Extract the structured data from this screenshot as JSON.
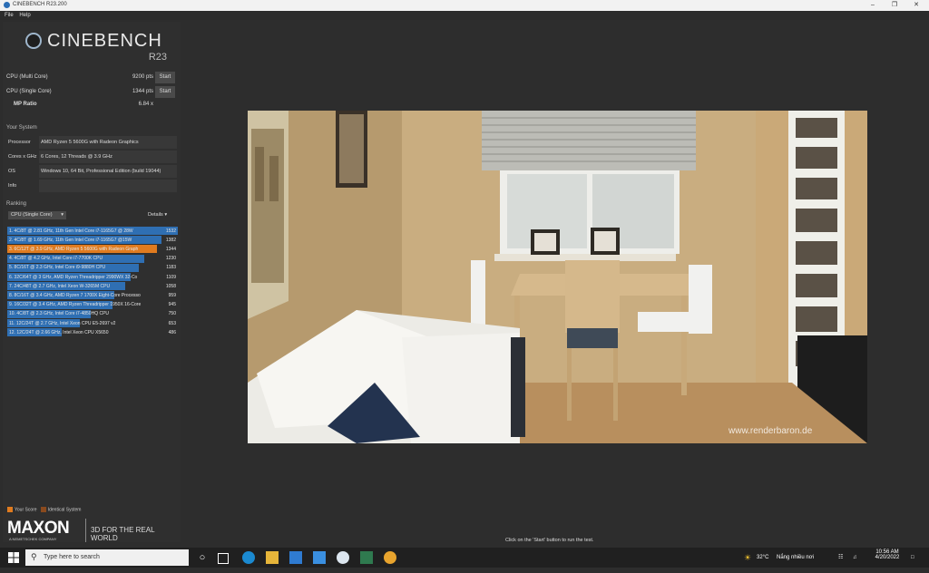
{
  "window": {
    "title": "CINEBENCH R23.200",
    "controls": [
      "minimize-icon",
      "maximize-icon",
      "close-icon"
    ]
  },
  "menu": {
    "items": [
      "File",
      "Help"
    ]
  },
  "logo": {
    "name": "CINEBENCH",
    "version": "R23"
  },
  "benchmarks": [
    {
      "label": "CPU (Multi Core)",
      "points": "9200 pts",
      "button": "Start"
    },
    {
      "label": "CPU (Single Core)",
      "points": "1344 pts",
      "button": "Start"
    }
  ],
  "mp_ratio": {
    "label": "MP Ratio",
    "value": "6.84 x"
  },
  "your_system": {
    "heading": "Your System",
    "rows": [
      {
        "key": "Processor",
        "value": "AMD Ryzen 5 5600G with Radeon Graphics"
      },
      {
        "key": "Cores x GHz",
        "value": "6 Cores, 12 Threads @ 3.9 GHz"
      },
      {
        "key": "OS",
        "value": "Windows 10, 64 Bit, Professional Edition (build 19044)"
      },
      {
        "key": "Info",
        "value": ""
      }
    ]
  },
  "ranking": {
    "heading": "Ranking",
    "dropdown": "CPU (Single Core)",
    "details": "Details",
    "max_score": 1532,
    "items": [
      {
        "label": "1. 4C/8T @ 2.81 GHz, 11th Gen Intel Core i7-1165G7 @ 28W",
        "score": "1532",
        "value": 1532,
        "highlight": false
      },
      {
        "label": "2. 4C/8T @ 1.69 GHz, 11th Gen Intel Core i7-1165G7 @15W",
        "score": "1382",
        "value": 1382,
        "highlight": false
      },
      {
        "label": "3. 6C/12T @ 3.9 GHz, AMD Ryzen 5 5600G with Radeon Graph",
        "score": "1344",
        "value": 1344,
        "highlight": true
      },
      {
        "label": "4. 4C/8T @ 4.2 GHz, Intel Core i7-7700K CPU",
        "score": "1230",
        "value": 1230,
        "highlight": false
      },
      {
        "label": "5. 8C/16T @ 2.3 GHz, Intel Core i9-9880H CPU",
        "score": "1183",
        "value": 1183,
        "highlight": false
      },
      {
        "label": "6. 32C/64T @ 3 GHz, AMD Ryzen Threadripper 2990WX 32-Co",
        "score": "1109",
        "value": 1109,
        "highlight": false
      },
      {
        "label": "7. 24C/48T @ 2.7 GHz, Intel Xeon W-3265M CPU",
        "score": "1058",
        "value": 1058,
        "highlight": false
      },
      {
        "label": "8. 8C/16T @ 3.4 GHz, AMD Ryzen 7 1700X Eight-Core Processo",
        "score": "959",
        "value": 959,
        "highlight": false
      },
      {
        "label": "9. 16C/32T @ 3.4 GHz, AMD Ryzen Threadripper 1950X 16-Core",
        "score": "945",
        "value": 945,
        "highlight": false
      },
      {
        "label": "10. 4C/8T @ 2.3 GHz, Intel Core i7-4850HQ CPU",
        "score": "750",
        "value": 750,
        "highlight": false
      },
      {
        "label": "11. 12C/24T @ 2.7 GHz, Intel Xeon CPU E5-2697 v2",
        "score": "653",
        "value": 653,
        "highlight": false
      },
      {
        "label": "12. 12C/24T @ 2.66 GHz, Intel Xeon CPU X5650",
        "score": "486",
        "value": 486,
        "highlight": false
      }
    ]
  },
  "legend": {
    "your_score": "Your Score",
    "identical_system": "Identical System"
  },
  "branding": {
    "maxon": "MAXON",
    "maxon_sub": "A NEMETSCHEK COMPANY",
    "tagline": "3D FOR THE REAL WORLD"
  },
  "render": {
    "watermark": "www.renderbaron.de"
  },
  "hint": "Click on the 'Start' button to run the test.",
  "taskbar": {
    "search_placeholder": "Type here to search",
    "weather_temp": "32°C",
    "weather_text": "Nắng nhiều nơi",
    "time": "10:56 AM",
    "date": "4/20/2022"
  },
  "colors": {
    "bar": "#2f6fb3",
    "highlight": "#e07b1f",
    "identical": "#8a4a1e"
  }
}
